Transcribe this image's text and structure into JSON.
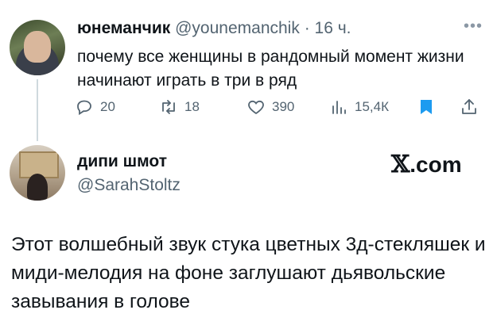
{
  "tweet": {
    "author_name": "юнеманчик",
    "author_handle": "@younemanchik",
    "separator": "·",
    "time": "16 ч.",
    "text": "почему все женщины в рандомный момент жизни начинают играть в три в ряд",
    "stats": {
      "replies": "20",
      "retweets": "18",
      "likes": "390",
      "views": "15,4К"
    },
    "icons": {
      "more": "more-dots-icon",
      "reply": "reply-icon",
      "retweet": "retweet-icon",
      "like": "heart-icon",
      "views": "views-icon",
      "bookmark": "bookmark-icon",
      "share": "share-icon"
    },
    "bookmark_color": "#1d9bf0"
  },
  "reply": {
    "author_name": "дипи шмот",
    "author_handle": "@SarahStoltz",
    "brand": {
      "x": "𝕏",
      "rest": ".com"
    },
    "text": "Этот волшебный звук стука цветных 3д-стекляшек и миди-мелодия на фоне заглушают дьявольские завывания в голове"
  }
}
